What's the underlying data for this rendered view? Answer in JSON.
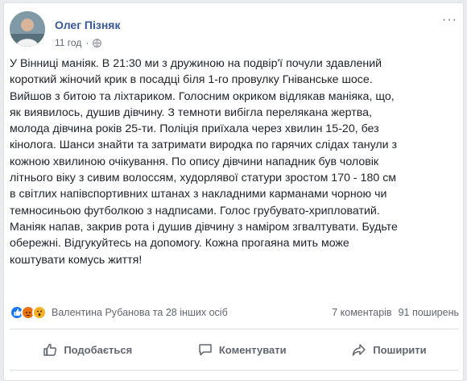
{
  "post": {
    "author": "Олег Пізняк",
    "time": "11 год",
    "more_label": "···",
    "text": "У Вінниці маніяк. В 21:30 ми з дружиною на подвір'ї почули здавлений\nкороткий жіночий крик в посадці біля 1-го провулку Гніванське шосе.\nВийшов з битою та ліхтариком. Голосним окриком відлякав маніяка, що,\nяк виявилось, душив дівчину. З темноти вибігла перелякана жертва,\nмолода дівчина років 25-ти. Поліція приїхала через хвилин 15-20, без\nкінолога. Шанси знайти та затримати виродка по гарячих слідах танули з\nкожною хвилиною очікування. По опису дівчини нападник був чоловік\nлітнього віку з сивим волоссям, худорлявої статури зростом 170 - 180 см\nв світлих напівспортивних штанах з накладними карманами чорною чи\nтемносиньою футболкою з надписами. Голос грубувато-хрипловатий.\nМаніяк напав, закрив рота і душив дівчину з наміром згвалтувати. Будьте\nобережні. Відгукуйтесь на допомогу. Кожна прогаяна мить може\nкоштувати комусь життя!"
  },
  "reactions": {
    "names": "Валентина Рубанова та 28 інших осіб",
    "comments": "7 коментарів",
    "shares": "91 поширень",
    "icons": [
      "like-reaction-icon",
      "angry-reaction-icon",
      "wow-reaction-icon"
    ]
  },
  "actions": {
    "like": "Подобається",
    "comment": "Коментувати",
    "share": "Поширити"
  },
  "colors": {
    "author": "#365899",
    "secondary_text": "#606770",
    "like": "#1877f2",
    "angry": "#e9710f",
    "wow": "#f7b125"
  }
}
